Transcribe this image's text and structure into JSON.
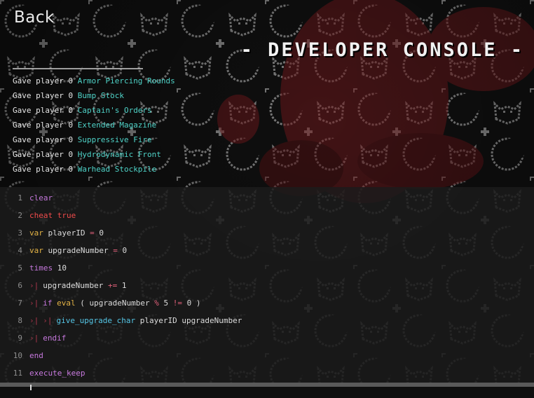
{
  "header": {
    "back_label": "Back",
    "title": "- DEVELOPER CONSOLE -"
  },
  "log": [
    {
      "prefix": "Gave player 0 ",
      "item": "Armor Piercing Rounds"
    },
    {
      "prefix": "Gave player 0 ",
      "item": "Bump Stock"
    },
    {
      "prefix": "Gave player 0 ",
      "item": "Captain's Orders"
    },
    {
      "prefix": "Gave player 0 ",
      "item": "Extended Magazine"
    },
    {
      "prefix": "Gave player 0 ",
      "item": "Suppressive Fire"
    },
    {
      "prefix": "Gave player 0 ",
      "item": "Hydrodynamic Front"
    },
    {
      "prefix": "Gave player 0 ",
      "item": "Warhead Stockpile"
    }
  ],
  "editor": {
    "lines": [
      {
        "num": "1",
        "tokens": [
          {
            "t": "clear",
            "c": "kw"
          }
        ]
      },
      {
        "num": "2",
        "tokens": [
          {
            "t": "cheat",
            "c": "kw-red"
          },
          {
            "t": " "
          },
          {
            "t": "true",
            "c": "kw-red"
          }
        ]
      },
      {
        "num": "3",
        "tokens": [
          {
            "t": "var",
            "c": "kw-y"
          },
          {
            "t": " playerID "
          },
          {
            "t": "=",
            "c": "op"
          },
          {
            "t": " 0"
          }
        ]
      },
      {
        "num": "4",
        "tokens": [
          {
            "t": "var",
            "c": "kw-y"
          },
          {
            "t": " upgradeNumber "
          },
          {
            "t": "=",
            "c": "op"
          },
          {
            "t": " 0"
          }
        ]
      },
      {
        "num": "5",
        "tokens": [
          {
            "t": "times",
            "c": "kw"
          },
          {
            "t": " 10"
          }
        ]
      },
      {
        "num": "6",
        "indent": 1,
        "tokens": [
          {
            "t": "upgradeNumber "
          },
          {
            "t": "+=",
            "c": "op"
          },
          {
            "t": " 1"
          }
        ]
      },
      {
        "num": "7",
        "indent": 1,
        "tokens": [
          {
            "t": "if",
            "c": "kw"
          },
          {
            "t": " "
          },
          {
            "t": "eval",
            "c": "kw-y"
          },
          {
            "t": " ( upgradeNumber "
          },
          {
            "t": "%",
            "c": "op"
          },
          {
            "t": " 5 "
          },
          {
            "t": "!=",
            "c": "op"
          },
          {
            "t": " 0 )"
          }
        ]
      },
      {
        "num": "8",
        "indent": 2,
        "tokens": [
          {
            "t": "give_upgrade_char",
            "c": "fn"
          },
          {
            "t": " playerID upgradeNumber"
          }
        ]
      },
      {
        "num": "9",
        "indent": 1,
        "tokens": [
          {
            "t": "endif",
            "c": "kw"
          }
        ]
      },
      {
        "num": "10",
        "tokens": [
          {
            "t": "end",
            "c": "kw"
          }
        ]
      },
      {
        "num": "11",
        "tokens": [
          {
            "t": "execute_keep",
            "c": "kw"
          }
        ]
      }
    ]
  },
  "colors": {
    "log_item": "#4fd3c8",
    "keyword": "#c678dd",
    "keyword_alt": "#e5b446",
    "keyword_red": "#ef4b4b",
    "function": "#55c6e6",
    "operator": "#e0607a",
    "background_pattern": "#a5a5a5",
    "background_accent": "#8f1f23"
  },
  "icons": {
    "indent_marker": "indent-arrow-icon",
    "pattern": [
      "crescent-moon-icon",
      "fox-head-icon",
      "cross-icon"
    ]
  }
}
